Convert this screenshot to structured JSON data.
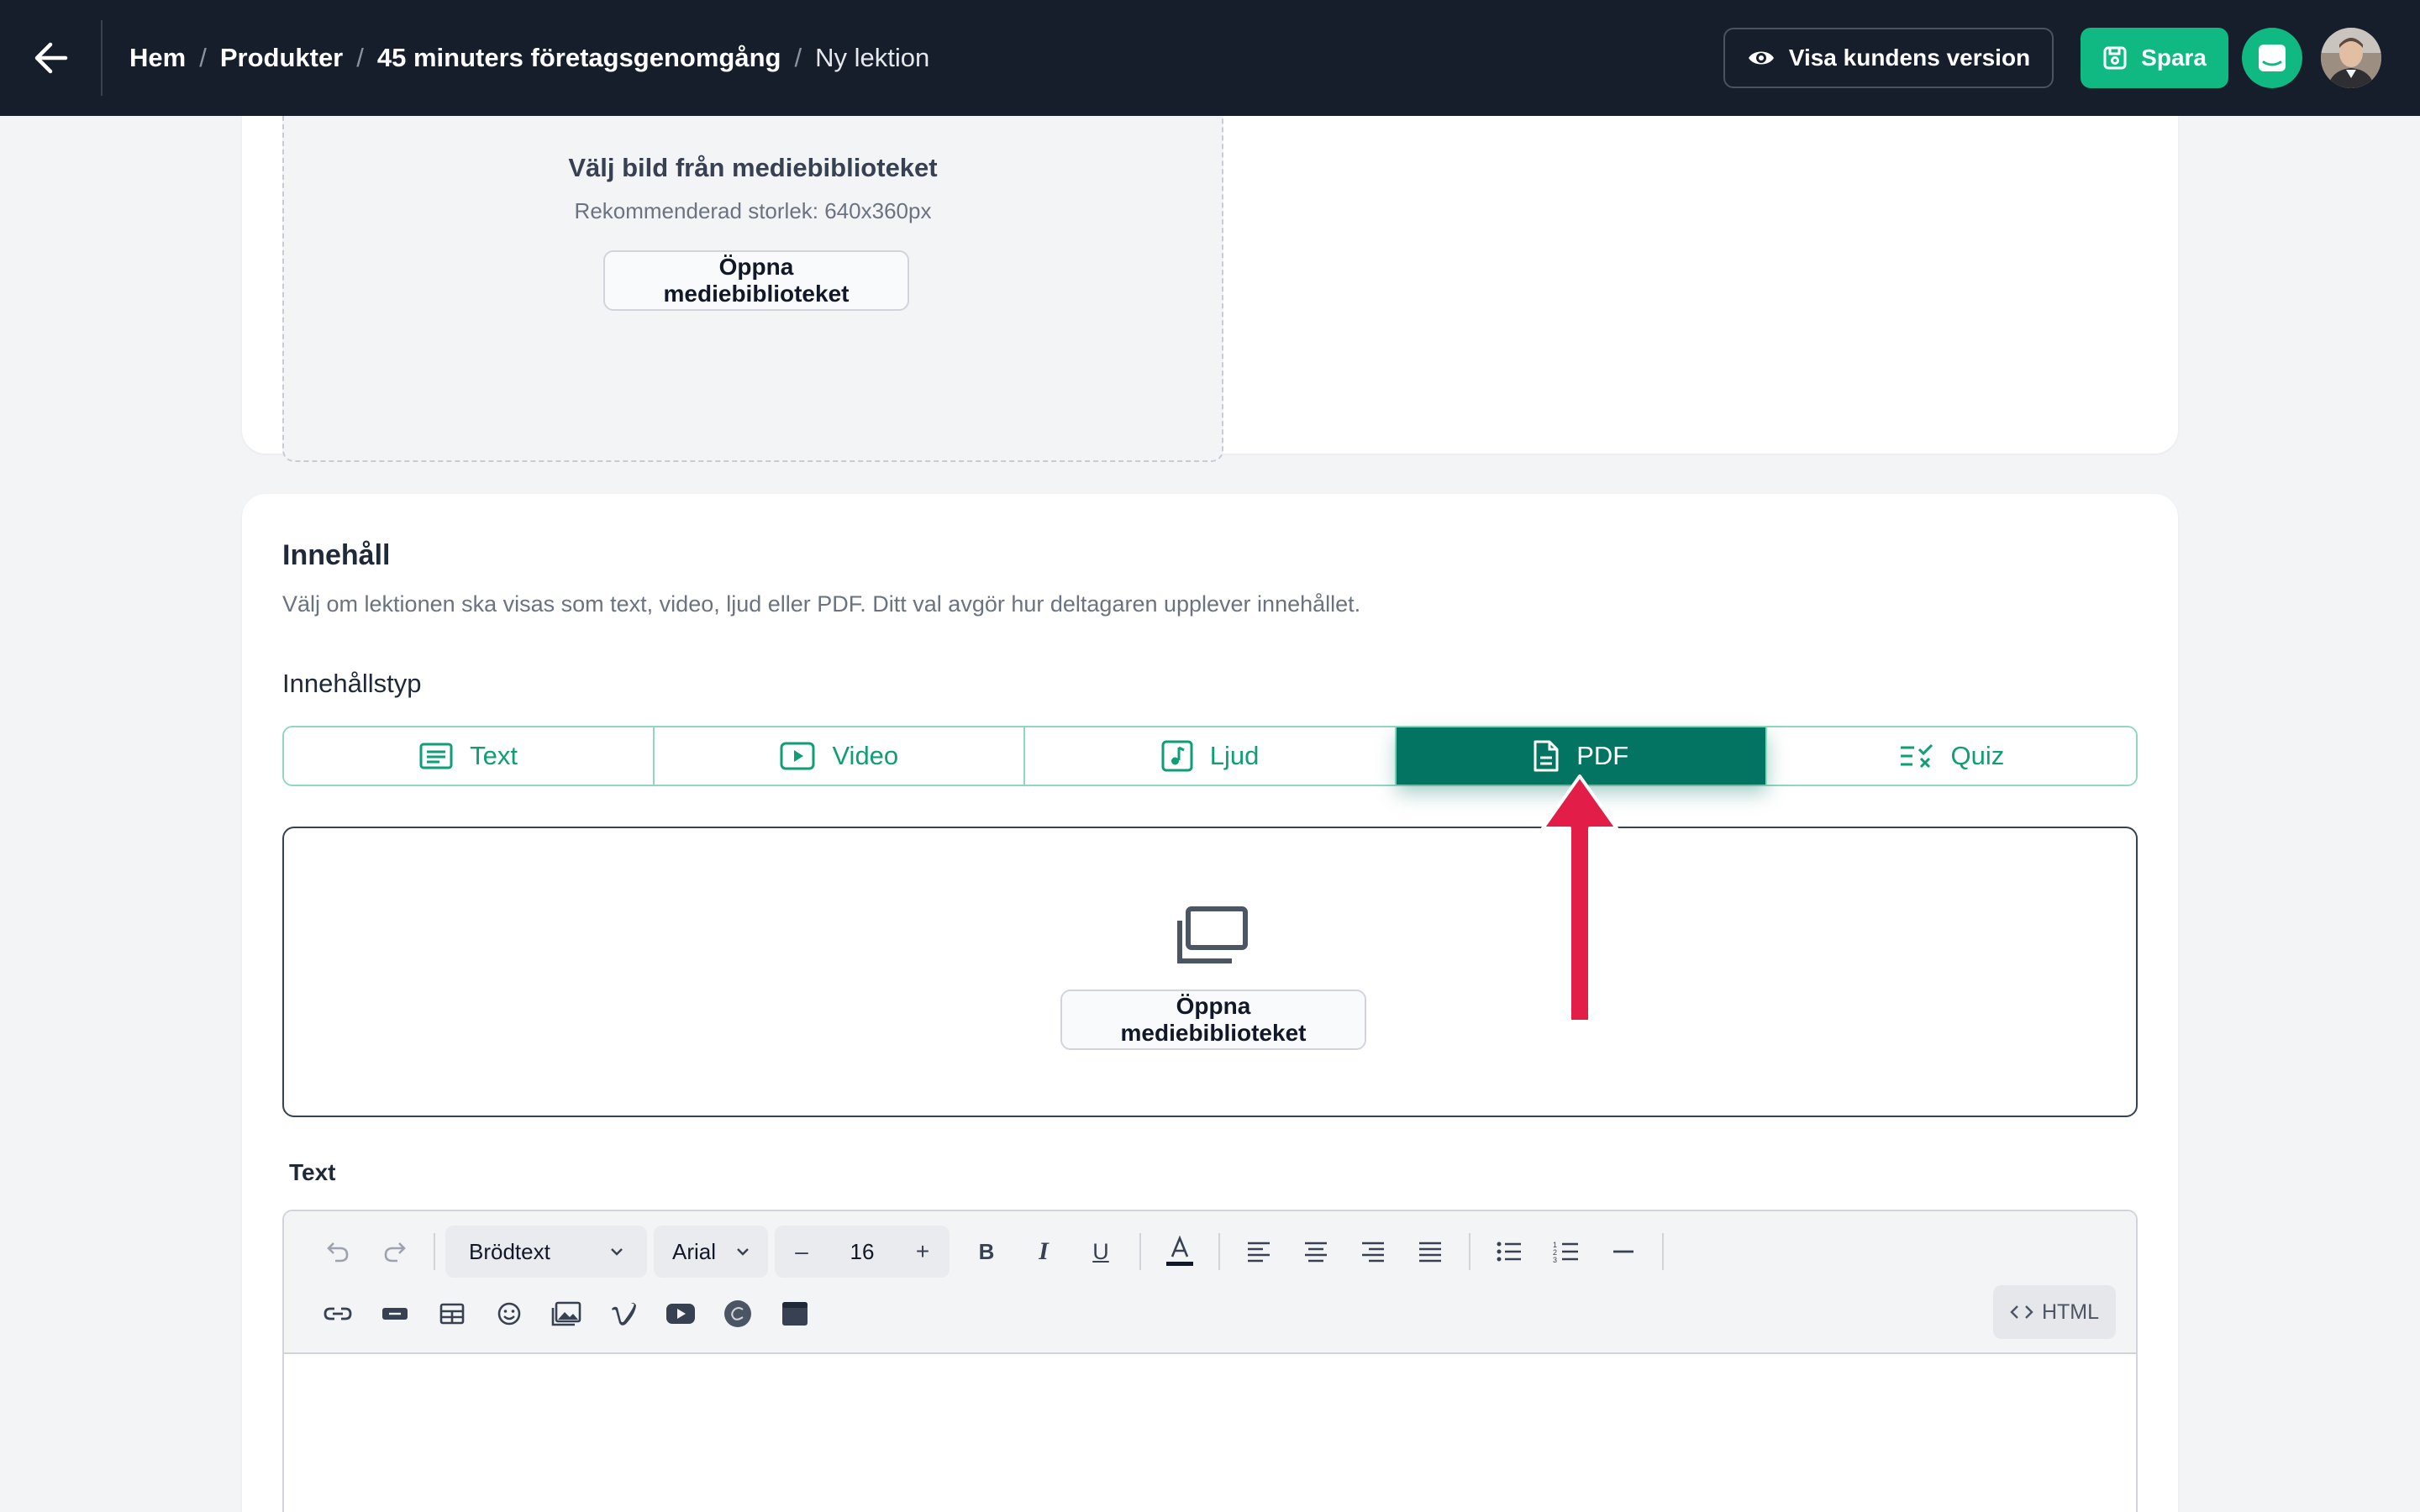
{
  "header": {
    "breadcrumb": [
      {
        "label": "Hem"
      },
      {
        "label": "Produkter"
      },
      {
        "label": "45 minuters företagsgenomgång"
      },
      {
        "label": "Ny lektion"
      }
    ],
    "separator": "/",
    "preview_label": "Visa kundens version",
    "save_label": "Spara"
  },
  "image_section": {
    "title": "Välj bild från mediebiblioteket",
    "hint": "Rekommenderad storlek: 640x360px",
    "button_label": "Öppna mediebiblioteket"
  },
  "content": {
    "title": "Innehåll",
    "description": "Välj om lektionen ska visas som text, video, ljud eller PDF. Ditt val avgör hur deltagaren upplever innehållet.",
    "type_label": "Innehållstyp",
    "tabs": [
      {
        "label": "Text",
        "icon": "text-icon"
      },
      {
        "label": "Video",
        "icon": "video-icon"
      },
      {
        "label": "Ljud",
        "icon": "audio-icon"
      },
      {
        "label": "PDF",
        "icon": "pdf-icon",
        "active": true
      },
      {
        "label": "Quiz",
        "icon": "quiz-icon"
      }
    ],
    "upload_button_label": "Öppna mediebiblioteket"
  },
  "editor": {
    "label": "Text",
    "block_format": "Brödtext",
    "font": "Arial",
    "font_size": "16",
    "html_label": "HTML"
  },
  "colors": {
    "topbar": "#171e2b",
    "accent": "#10b981",
    "active_tab": "#047462",
    "arrow": "#e11d48"
  }
}
